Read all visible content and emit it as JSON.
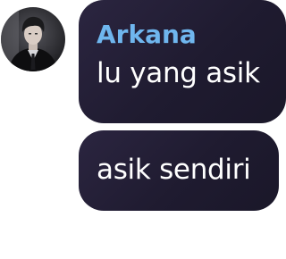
{
  "chat": {
    "avatar_icon": "user-photo-avatar",
    "sender_color": "#6fb6ee",
    "bubble_color": "#221d33",
    "messages": [
      {
        "sender": "Arkana",
        "text": "lu yang asik"
      },
      {
        "sender": "",
        "text": "asik sendiri"
      }
    ]
  }
}
